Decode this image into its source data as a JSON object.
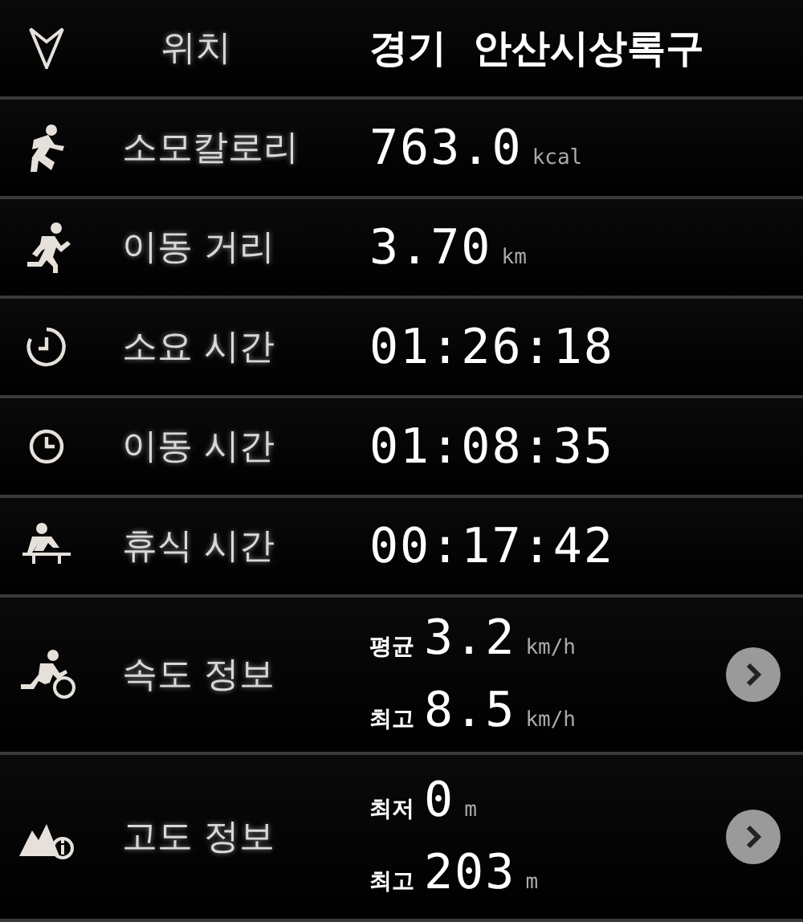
{
  "location": {
    "label": "위치",
    "value": "경기  안산시상록구"
  },
  "rows": [
    {
      "kind": "single",
      "label": "소모칼로리",
      "value": "763.0",
      "unit": "kcal"
    },
    {
      "kind": "single",
      "label": "이동 거리",
      "value": "3.70",
      "unit": "km"
    },
    {
      "kind": "single",
      "label": "소요 시간",
      "value": "01:26:18"
    },
    {
      "kind": "single",
      "label": "이동 시간",
      "value": "01:08:35"
    },
    {
      "kind": "single",
      "label": "휴식 시간",
      "value": "00:17:42"
    },
    {
      "kind": "multi",
      "label": "속도 정보",
      "entries": [
        {
          "prefix": "평균",
          "value": "3.2",
          "unit": "km/h"
        },
        {
          "prefix": "최고",
          "value": "8.5",
          "unit": "km/h"
        }
      ]
    },
    {
      "kind": "multi",
      "label": "고도 정보",
      "entries": [
        {
          "prefix": "최저",
          "value": "0",
          "unit": "m"
        },
        {
          "prefix": "최고",
          "value": "203",
          "unit": "m"
        }
      ]
    }
  ]
}
